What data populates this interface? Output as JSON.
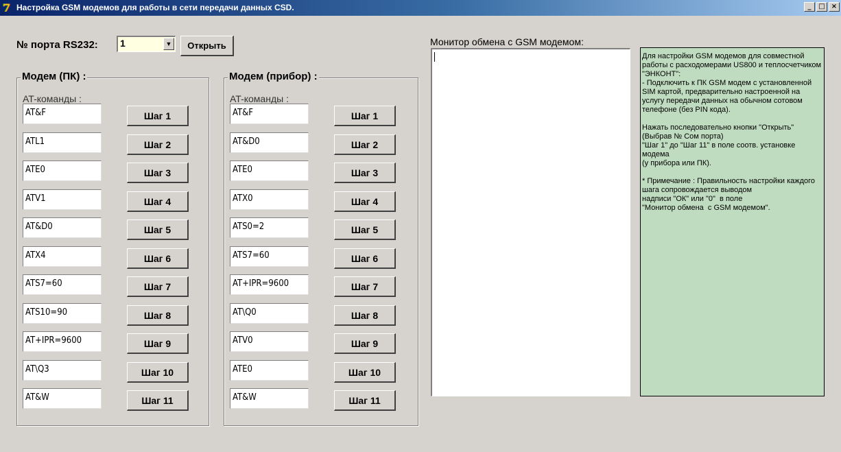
{
  "window": {
    "title": "Настройка GSM модемов для работы в сети передачи данных CSD.",
    "minimize": "_",
    "maximize": "□",
    "close": "×"
  },
  "port": {
    "label": "№ порта RS232:",
    "value": "1",
    "open_label": "Открыть"
  },
  "pc_group": {
    "title": "Модем (ПК) :",
    "commands_label": "AT-команды :",
    "rows": [
      {
        "cmd": "AT&F",
        "step": "Шаг 1"
      },
      {
        "cmd": "ATL1",
        "step": "Шаг 2"
      },
      {
        "cmd": "ATE0",
        "step": "Шаг 3"
      },
      {
        "cmd": "ATV1",
        "step": "Шаг 4"
      },
      {
        "cmd": "AT&D0",
        "step": "Шаг 5"
      },
      {
        "cmd": "ATX4",
        "step": "Шаг 6"
      },
      {
        "cmd": "ATS7=60",
        "step": "Шаг 7"
      },
      {
        "cmd": "ATS10=90",
        "step": "Шаг 8"
      },
      {
        "cmd": "AT+IPR=9600",
        "step": "Шаг 9"
      },
      {
        "cmd": "AT\\Q3",
        "step": "Шаг 10"
      },
      {
        "cmd": "AT&W",
        "step": "Шаг 11"
      }
    ]
  },
  "dev_group": {
    "title": "Модем (прибор) :",
    "commands_label": "AT-команды :",
    "rows": [
      {
        "cmd": "AT&F",
        "step": "Шаг 1"
      },
      {
        "cmd": "AT&D0",
        "step": "Шаг 2"
      },
      {
        "cmd": "ATE0",
        "step": "Шаг 3"
      },
      {
        "cmd": "ATX0",
        "step": "Шаг 4"
      },
      {
        "cmd": "ATS0=2",
        "step": "Шаг 5"
      },
      {
        "cmd": "ATS7=60",
        "step": "Шаг 6"
      },
      {
        "cmd": "AT+IPR=9600",
        "step": "Шаг 7"
      },
      {
        "cmd": "AT\\Q0",
        "step": "Шаг 8"
      },
      {
        "cmd": "ATV0",
        "step": "Шаг 9"
      },
      {
        "cmd": "ATE0",
        "step": "Шаг 10"
      },
      {
        "cmd": "AT&W",
        "step": "Шаг 11"
      }
    ]
  },
  "monitor": {
    "label": "Монитор обмена с GSM модемом:",
    "content": ""
  },
  "instructions": {
    "p1": "Для настройки GSM модемов для совместной работы с расходомерами US800 и теплосчетчиком \"ЭНКОНТ\":\n- Подключить к ПК GSM модем с установленной SIM картой, предварительно настроенной на услугу передачи данных на обычном сотовом телефоне (без PIN кода).",
    "p2": "Нажать последовательно кнопки \"Открыть\" (Выбрав № Сом порта)\n\"Шаг 1\" до \"Шаг 11\" в поле соотв. установке модема\n(у прибора или ПК).",
    "p3": "* Примечание : Правильность настройки каждого шага сопровождается выводом\nнадписи \"ОК\" или \"0\"  в поле\n\"Монитор обмена  с GSM модемом\"."
  },
  "colors": {
    "window_bg": "#d6d3ce",
    "title_start": "#0a246a",
    "title_end": "#a6caf0",
    "combo_bg": "#ffffe1",
    "note_bg": "#c0dcc0"
  }
}
